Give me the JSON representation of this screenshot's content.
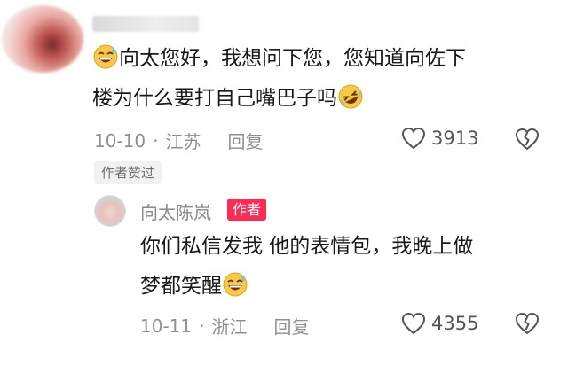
{
  "comment1": {
    "text_a": "向太您好，我想问下您，您知道向佐下",
    "text_b": "楼为什么要打自己嘴巴子吗",
    "emoji_lead": "laughing-sweat-icon",
    "emoji_tail": "rolling-laughing-icon",
    "date": "10-10",
    "location": "江苏",
    "reply_label": "回复",
    "like_count": "3913"
  },
  "liked_badge": "作者赞过",
  "reply": {
    "author_name": "向太陈岚",
    "author_tag": "作者",
    "text_a": "你们私信发我  他的表情包，我晚上做",
    "text_b": "梦都笑醒",
    "emoji_tail": "laughing-sweat-icon",
    "date": "10-11",
    "location": "浙江",
    "reply_label": "回复",
    "like_count": "4355"
  },
  "colors": {
    "author_tag_bg": "#fe2c55",
    "meta_text": "#8f8f8f"
  }
}
